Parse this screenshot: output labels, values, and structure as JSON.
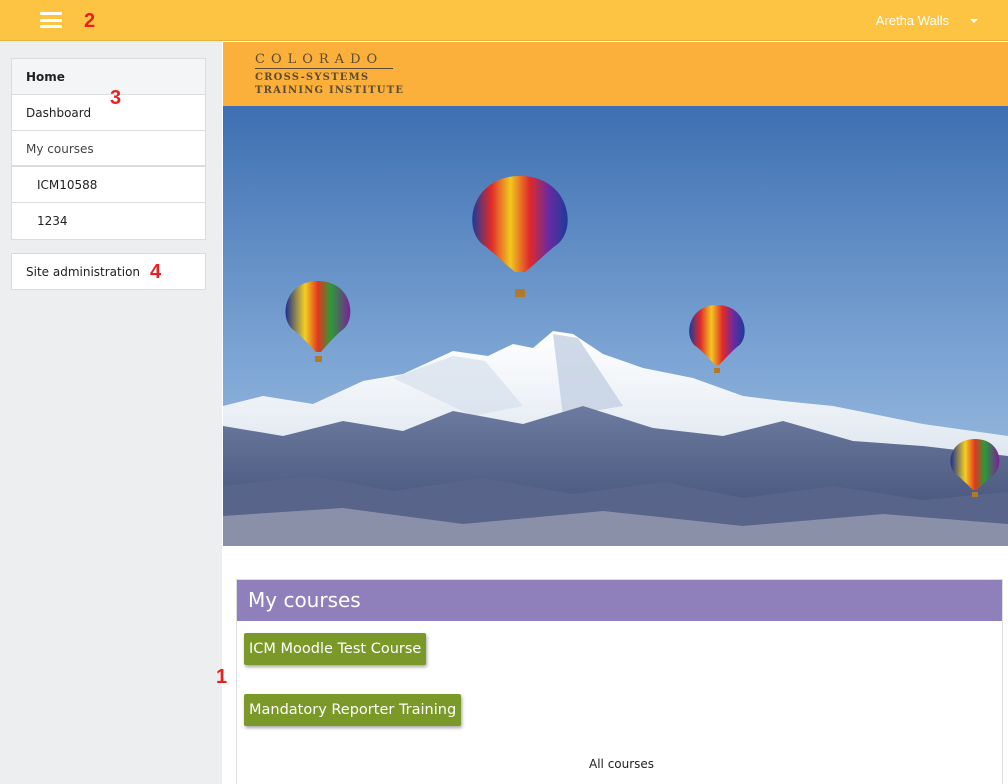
{
  "navbar": {
    "menu_icon": "hamburger-menu-icon",
    "user_name": "Aretha Walls",
    "user_caret_icon": "caret-down-icon",
    "color": "#fdc443"
  },
  "markers": {
    "m1": "1",
    "m2": "2",
    "m3": "3",
    "m4": "4"
  },
  "sidebar": {
    "nav": [
      "Home",
      "Dashboard",
      "My courses",
      "ICM10588",
      "1234"
    ],
    "admin": "Site administration"
  },
  "brand": {
    "line1": "COLORADO",
    "line2": "CROSS-SYSTEMS",
    "line3": "TRAINING INSTITUTE",
    "color": "#fbb03b"
  },
  "hero": {
    "description_icon": "hot-air-balloons-over-mountains-image"
  },
  "courses": {
    "title": "My courses",
    "items": [
      "ICM Moodle Test Course",
      "Mandatory Reporter Training"
    ],
    "all_link": "All courses",
    "header_color": "#8f7fba",
    "button_color": "#7a9928"
  }
}
